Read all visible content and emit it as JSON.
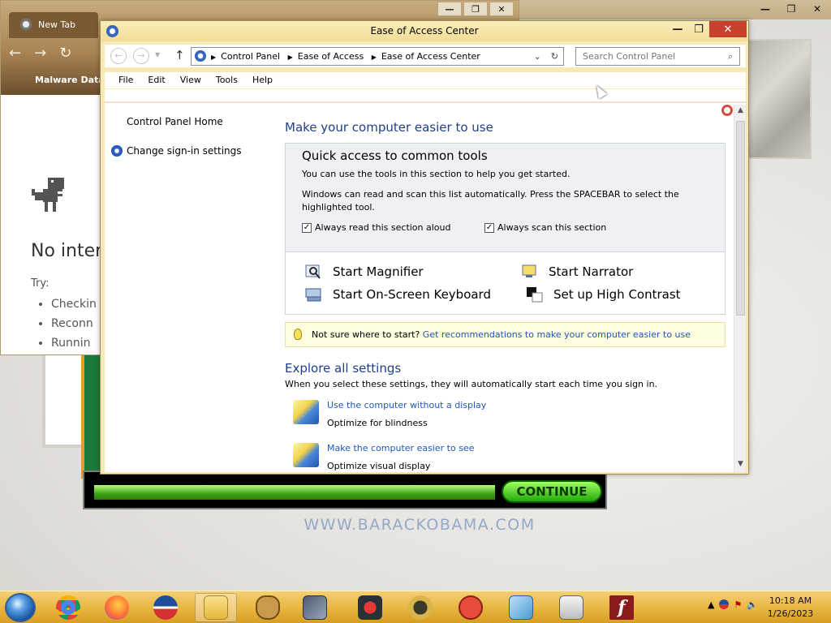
{
  "chrome": {
    "tab_title": "New Tab",
    "bookmark": "Malware Databo",
    "error_title": "No intern",
    "try_label": "Try:",
    "try_items": [
      "Checkin",
      "Reconn",
      "Runnin"
    ]
  },
  "eoa": {
    "window_title": "Ease of Access Center",
    "breadcrumbs": [
      "Control Panel",
      "Ease of Access",
      "Ease of Access Center"
    ],
    "search_placeholder": "Search Control Panel",
    "menu": [
      "File",
      "Edit",
      "View",
      "Tools",
      "Help"
    ],
    "left_pane": {
      "home": "Control Panel Home",
      "signin": "Change sign-in settings"
    },
    "heading": "Make your computer easier to use",
    "quick_access": {
      "title": "Quick access to common tools",
      "p1": "You can use the tools in this section to help you get started.",
      "p2": "Windows can read and scan this list automatically.  Press the SPACEBAR to select the highlighted tool.",
      "check_read": "Always read this section aloud",
      "check_scan": "Always scan this section",
      "tools": {
        "magnifier": "Start Magnifier",
        "narrator": "Start Narrator",
        "keyboard": "Start On-Screen Keyboard",
        "contrast": "Set up High Contrast"
      }
    },
    "not_sure": {
      "text": "Not sure where to start?",
      "link": "Get recommendations to make your computer easier to use"
    },
    "explore": {
      "heading": "Explore all settings",
      "sub": "When you select these settings, they will automatically start each time you sign in.",
      "items": [
        {
          "link": "Use the computer without a display",
          "desc": "Optimize for blindness"
        },
        {
          "link": "Make the computer easier to see",
          "desc": "Optimize visual display"
        }
      ]
    }
  },
  "ad": {
    "continue_label": "CONTINUE",
    "url": "WWW.BARACKOBAMA.COM"
  },
  "taskbar": {
    "time": "10:18 AM",
    "date": "1/26/2023"
  },
  "colors": {
    "taskbar": "#eab845",
    "eoa_frame": "#f7e8b8",
    "link": "#1f57b5",
    "heading": "#1e3e8a",
    "close_button": "#c9402c"
  }
}
